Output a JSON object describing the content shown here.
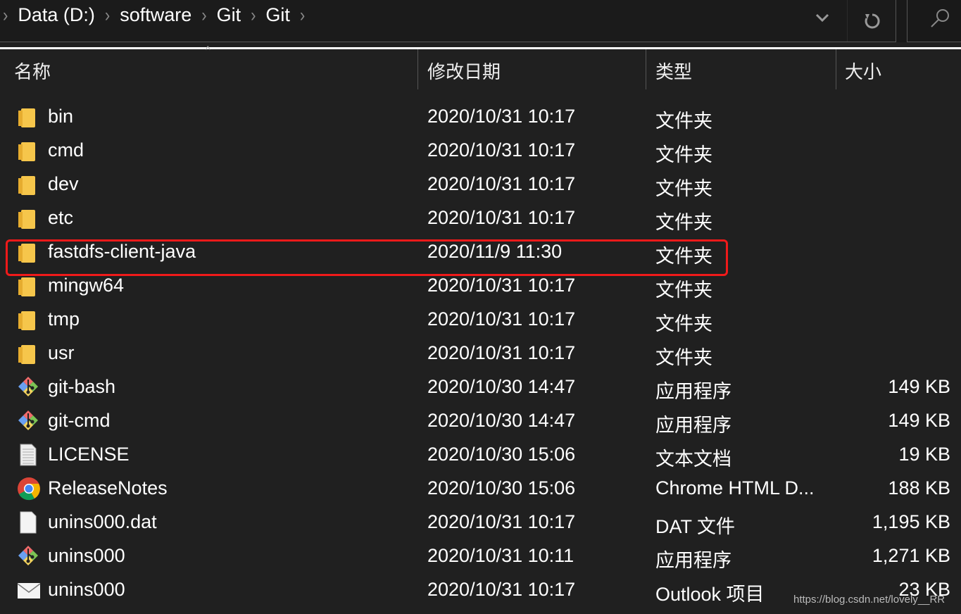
{
  "breadcrumb": [
    "Data (D:)",
    "software",
    "Git",
    "Git"
  ],
  "columns": {
    "name": "名称",
    "date": "修改日期",
    "type": "类型",
    "size": "大小"
  },
  "files": [
    {
      "name": "bin",
      "date": "2020/10/31 10:17",
      "type": "文件夹",
      "size": "",
      "icon": "folder"
    },
    {
      "name": "cmd",
      "date": "2020/10/31 10:17",
      "type": "文件夹",
      "size": "",
      "icon": "folder"
    },
    {
      "name": "dev",
      "date": "2020/10/31 10:17",
      "type": "文件夹",
      "size": "",
      "icon": "folder"
    },
    {
      "name": "etc",
      "date": "2020/10/31 10:17",
      "type": "文件夹",
      "size": "",
      "icon": "folder"
    },
    {
      "name": "fastdfs-client-java",
      "date": "2020/11/9 11:30",
      "type": "文件夹",
      "size": "",
      "icon": "folder"
    },
    {
      "name": "mingw64",
      "date": "2020/10/31 10:17",
      "type": "文件夹",
      "size": "",
      "icon": "folder"
    },
    {
      "name": "tmp",
      "date": "2020/10/31 10:17",
      "type": "文件夹",
      "size": "",
      "icon": "folder"
    },
    {
      "name": "usr",
      "date": "2020/10/31 10:17",
      "type": "文件夹",
      "size": "",
      "icon": "folder"
    },
    {
      "name": "git-bash",
      "date": "2020/10/30 14:47",
      "type": "应用程序",
      "size": "149 KB",
      "icon": "git"
    },
    {
      "name": "git-cmd",
      "date": "2020/10/30 14:47",
      "type": "应用程序",
      "size": "149 KB",
      "icon": "git"
    },
    {
      "name": "LICENSE",
      "date": "2020/10/30 15:06",
      "type": "文本文档",
      "size": "19 KB",
      "icon": "text"
    },
    {
      "name": "ReleaseNotes",
      "date": "2020/10/30 15:06",
      "type": "Chrome HTML D...",
      "size": "188 KB",
      "icon": "chrome"
    },
    {
      "name": "unins000.dat",
      "date": "2020/10/31 10:17",
      "type": "DAT 文件",
      "size": "1,195 KB",
      "icon": "file"
    },
    {
      "name": "unins000",
      "date": "2020/10/31 10:11",
      "type": "应用程序",
      "size": "1,271 KB",
      "icon": "git"
    },
    {
      "name": "unins000",
      "date": "2020/10/31 10:17",
      "type": "Outlook 项目",
      "size": "23 KB",
      "icon": "mail"
    }
  ],
  "highlight_color": "#f01a1a",
  "watermark": "https://blog.csdn.net/lovely__RR"
}
